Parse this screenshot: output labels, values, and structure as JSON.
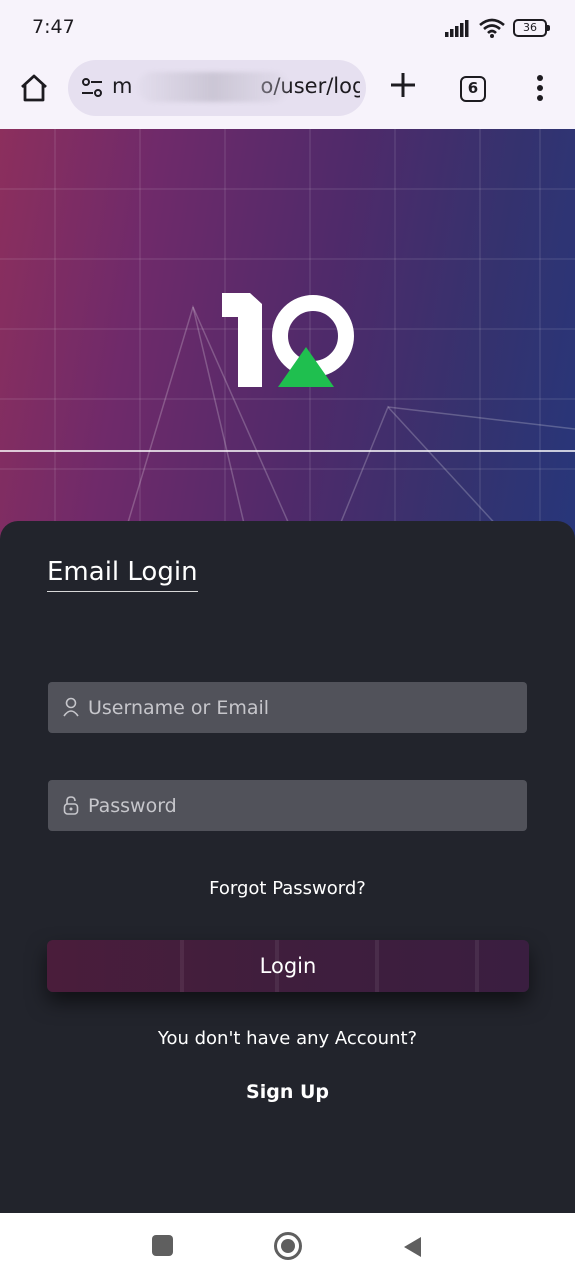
{
  "status_bar": {
    "time": "7:47",
    "battery": "36"
  },
  "browser": {
    "url_prefix": "m",
    "url_suffix": "o/user/log",
    "tab_count": "6"
  },
  "brand": {
    "accent_green": "#1fbf4f",
    "logo_text": "10"
  },
  "login": {
    "tab_title": "Email Login",
    "username_placeholder": "Username or Email",
    "password_placeholder": "Password",
    "forgot_label": "Forgot Password?",
    "login_label": "Login",
    "no_account_text": "You don't have any Account?",
    "signup_label": "Sign Up"
  },
  "icons": {
    "home": "home-icon",
    "tune": "tune-icon",
    "plus": "plus-icon",
    "menu": "more-vert-icon",
    "user": "user-icon",
    "lock": "lock-icon",
    "nav_recent": "square-icon",
    "nav_home": "circle-icon",
    "nav_back": "back-triangle-icon"
  }
}
